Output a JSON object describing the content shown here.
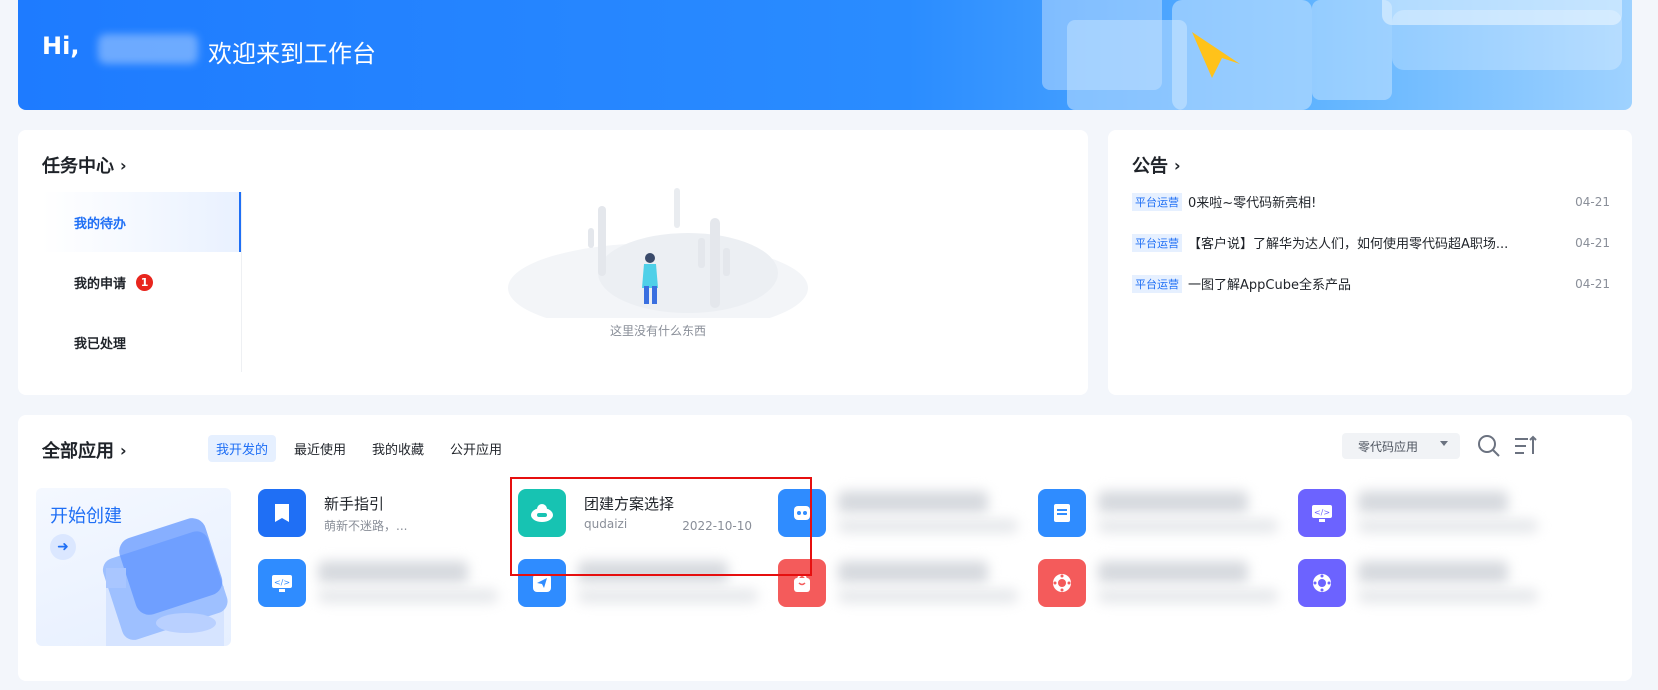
{
  "banner": {
    "greeting": "Hi,",
    "welcome": "欢迎来到工作台"
  },
  "task_center": {
    "title": "任务中心",
    "tabs": [
      {
        "label": "我的待办",
        "active": true
      },
      {
        "label": "我的申请",
        "badge": "1"
      },
      {
        "label": "我已处理"
      }
    ],
    "empty_text": "这里没有什么东西"
  },
  "notices": {
    "title": "公告",
    "items": [
      {
        "tag": "平台运营",
        "text": "0来啦~零代码新亮相!",
        "date": "04-21"
      },
      {
        "tag": "平台运营",
        "text": "【客户说】了解华为达人们，如何使用零代码超A职场...",
        "date": "04-21"
      },
      {
        "tag": "平台运营",
        "text": "一图了解AppCube全系产品",
        "date": "04-21"
      }
    ]
  },
  "apps": {
    "title": "全部应用",
    "tabs": [
      {
        "label": "我开发的",
        "active": true
      },
      {
        "label": "最近使用"
      },
      {
        "label": "我的收藏"
      },
      {
        "label": "公开应用"
      }
    ],
    "filter_value": "零代码应用",
    "create_label": "开始创建",
    "items": [
      {
        "name": "新手指引",
        "sub": "萌新不迷路，...",
        "icon": "bookmark-icon",
        "color": "#1f6ff5"
      },
      {
        "name": "团建方案选择",
        "sub": "qudaizi",
        "date": "2022-10-10",
        "icon": "robot-cloud-icon",
        "color": "#17c3b2"
      },
      {
        "icon": "robot-icon",
        "color": "#2f8cff"
      },
      {
        "icon": "document-icon",
        "color": "#2f8cff"
      },
      {
        "icon": "code-monitor-icon",
        "color": "#6c63ff"
      },
      {
        "icon": "code-monitor-icon",
        "color": "#2f8cff"
      },
      {
        "icon": "paper-plane-icon",
        "color": "#2f8cff"
      },
      {
        "icon": "shopping-bag-icon",
        "color": "#f45b5b"
      },
      {
        "icon": "lifebuoy-icon",
        "color": "#f45b5b"
      },
      {
        "icon": "lifebuoy-icon",
        "color": "#6c63ff"
      }
    ]
  }
}
